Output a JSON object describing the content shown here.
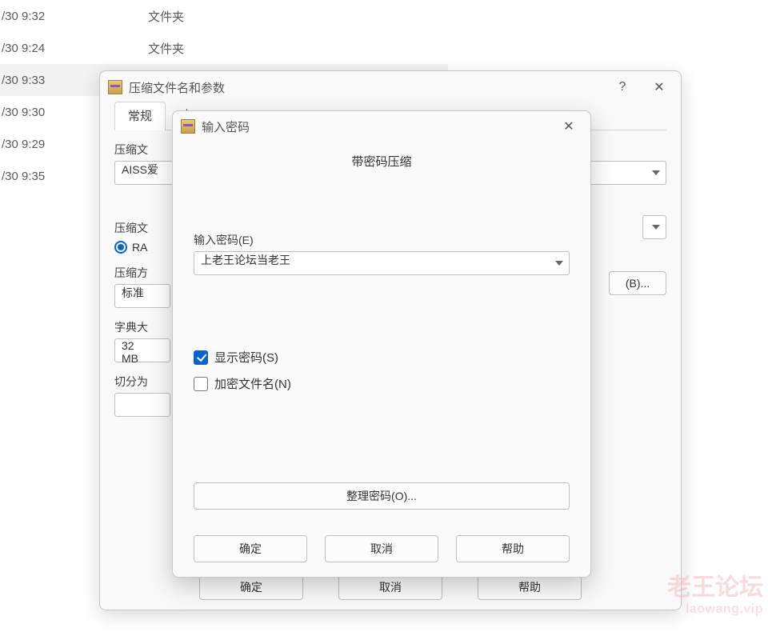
{
  "background": {
    "rows": [
      {
        "time": "/30 9:32",
        "type": "文件夹",
        "selected": false
      },
      {
        "time": "/30 9:24",
        "type": "文件夹",
        "selected": false
      },
      {
        "time": "/30 9:33",
        "type": "",
        "selected": true
      },
      {
        "time": "/30 9:30",
        "type": "",
        "selected": false
      },
      {
        "time": "/30 9:29",
        "type": "",
        "selected": false
      },
      {
        "time": "/30 9:35",
        "type": "",
        "selected": false
      }
    ]
  },
  "outer_dialog": {
    "title": "压缩文件名和参数",
    "help_glyph": "?",
    "close_glyph": "✕",
    "tabs": {
      "general": "常规",
      "next_partial": "高"
    },
    "labels": {
      "archive_name": "压缩文",
      "browse": "(B)...",
      "format": "压缩文",
      "method": "压缩方",
      "dict": "字典大",
      "split": "切分为"
    },
    "values": {
      "archive_name": "AISS爱",
      "format_radio": "RA",
      "method": "标准",
      "dict": "32 MB"
    },
    "buttons": {
      "ok": "确定",
      "cancel": "取消",
      "help": "帮助"
    }
  },
  "inner_dialog": {
    "title": "输入密码",
    "close_glyph": "✕",
    "subtitle": "带密码压缩",
    "labels": {
      "enter_password": "输入密码(E)",
      "show_password": "显示密码(S)",
      "encrypt_names": "加密文件名(N)",
      "organize": "整理密码(O)..."
    },
    "values": {
      "password": "上老王论坛当老王",
      "show_password_checked": true,
      "encrypt_names_checked": false
    },
    "buttons": {
      "ok": "确定",
      "cancel": "取消",
      "help": "帮助"
    }
  },
  "watermark": {
    "line1": "老王论坛",
    "line2": "laowang.vip"
  }
}
